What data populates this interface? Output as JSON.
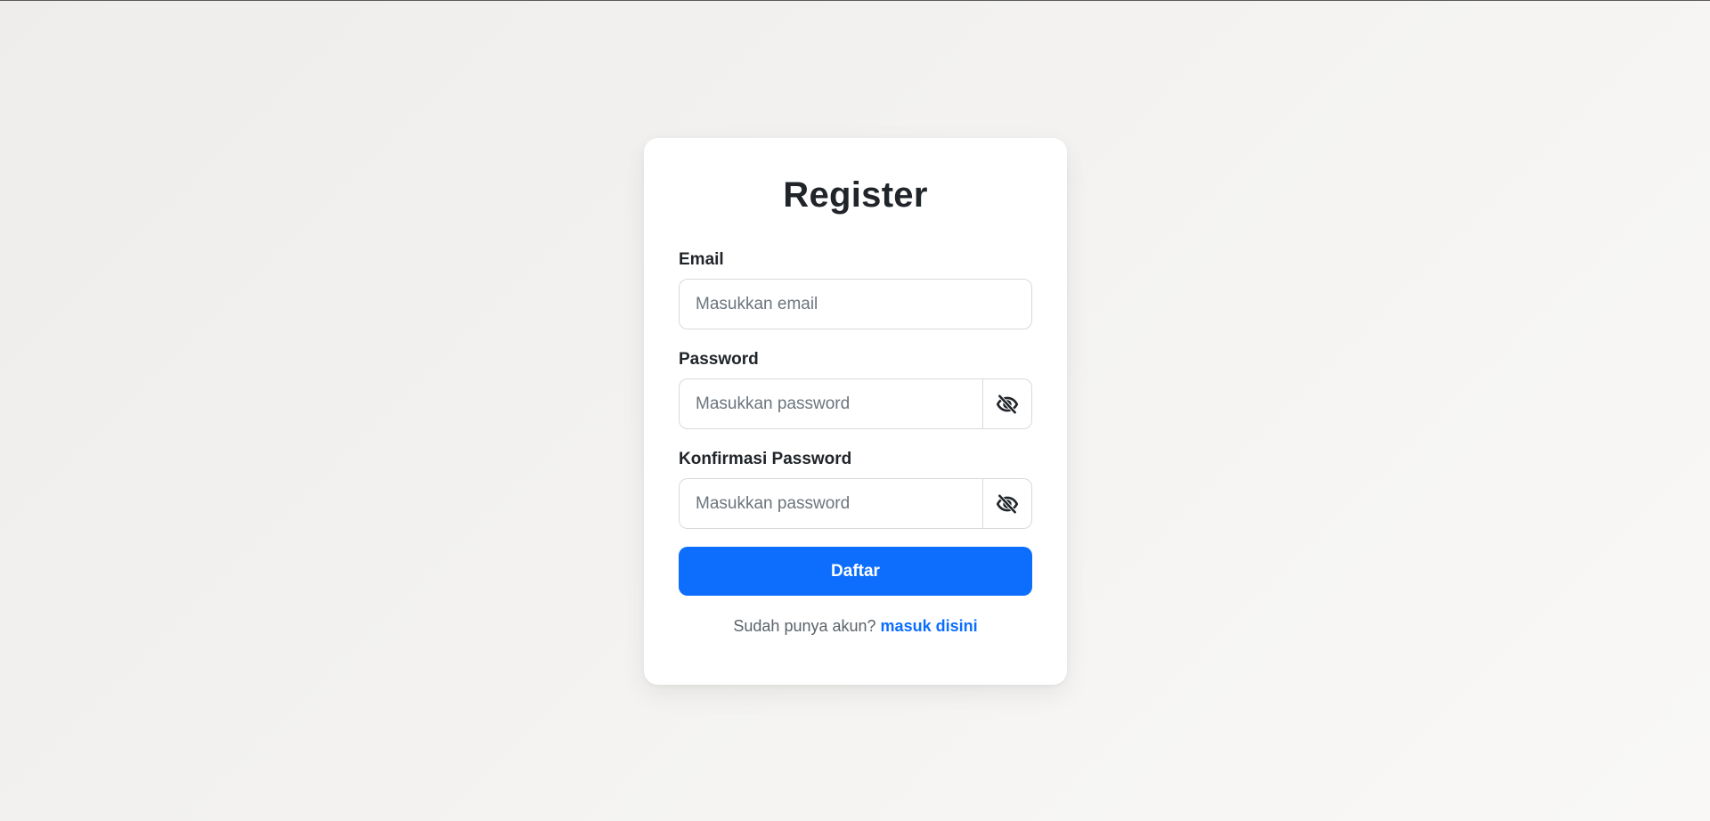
{
  "form": {
    "title": "Register",
    "email": {
      "label": "Email",
      "placeholder": "Masukkan email",
      "value": ""
    },
    "password": {
      "label": "Password",
      "placeholder": "Masukkan password",
      "value": "",
      "toggle_icon": "eye-slash-icon"
    },
    "confirm_password": {
      "label": "Konfirmasi Password",
      "placeholder": "Masukkan password",
      "value": "",
      "toggle_icon": "eye-slash-icon"
    },
    "submit_label": "Daftar",
    "footer": {
      "text": "Sudah punya akun?",
      "link_text": "masuk disini"
    }
  },
  "colors": {
    "primary": "#0d6efd",
    "card_background": "#ffffff",
    "text": "#212529",
    "muted_text": "#5c636a",
    "border": "#d6d9dc"
  }
}
